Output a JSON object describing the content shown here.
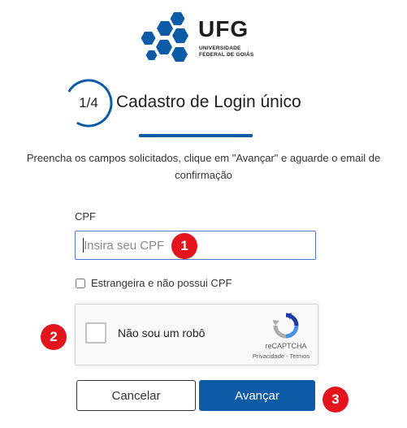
{
  "brand": {
    "name": "UFG",
    "subtitle_line1": "UNIVERSIDADE",
    "subtitle_line2": "FEDERAL DE GOIÁS",
    "color": "#0d5aa7"
  },
  "step": {
    "indicator": "1/4",
    "title": "Cadastro de Login único"
  },
  "instructions": {
    "line1": "Preencha os campos solicitados, clique em \"Avançar\" e aguarde o email de",
    "line2": "confirmação"
  },
  "form": {
    "cpf_label": "CPF",
    "cpf_value": "",
    "cpf_placeholder": "Insira seu CPF",
    "foreign_label": "Estrangeira e não possui CPF",
    "foreign_checked": false
  },
  "recaptcha": {
    "label": "Não sou um robô",
    "brand": "reCAPTCHA",
    "terms": "Privacidade - Termos"
  },
  "buttons": {
    "cancel": "Cancelar",
    "next": "Avançar"
  },
  "markers": [
    "1",
    "2",
    "3"
  ],
  "colors": {
    "primary": "#0d5aa7",
    "marker": "#e3141d",
    "input_border": "#4b79c4"
  }
}
